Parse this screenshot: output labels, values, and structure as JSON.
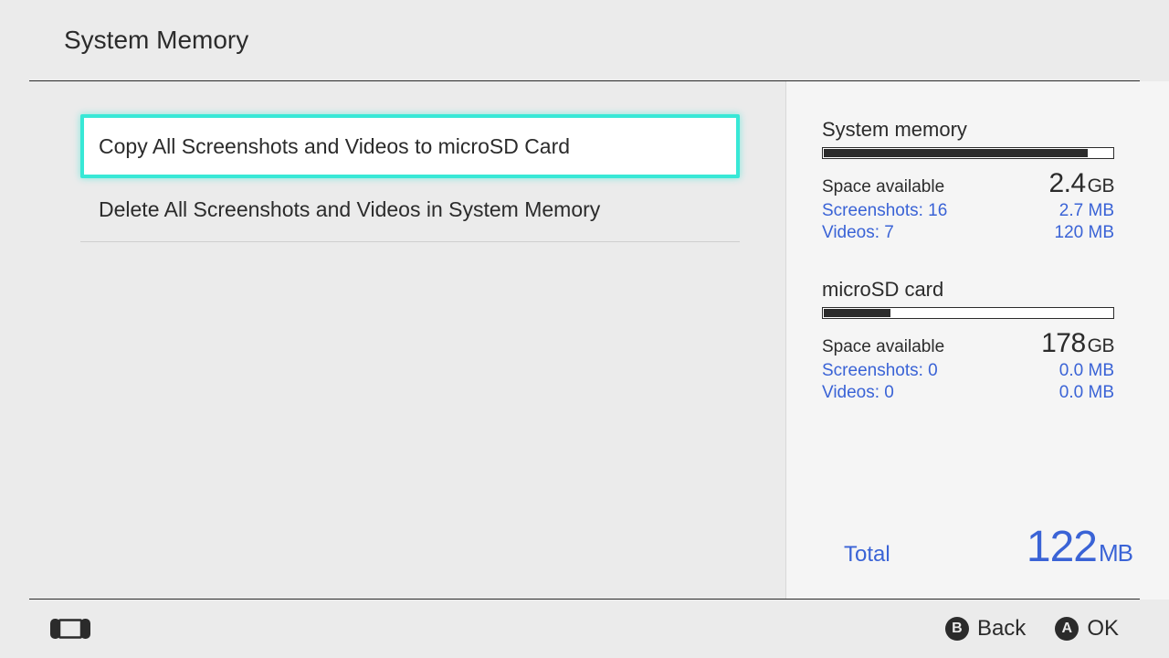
{
  "header": {
    "title": "System Memory"
  },
  "menu": {
    "items": [
      {
        "label": "Copy All Screenshots and Videos to microSD Card",
        "selected": true
      },
      {
        "label": "Delete All Screenshots and Videos in System Memory",
        "selected": false
      }
    ]
  },
  "panel": {
    "system": {
      "title": "System memory",
      "fill_pct": 91,
      "space_label": "Space available",
      "space_value": "2.4",
      "space_unit": "GB",
      "screenshots_label": "Screenshots: 16",
      "screenshots_value": "2.7 MB",
      "videos_label": "Videos: 7",
      "videos_value": "120 MB"
    },
    "microsd": {
      "title": "microSD card",
      "fill_pct": 23,
      "space_label": "Space available",
      "space_value": "178",
      "space_unit": "GB",
      "screenshots_label": "Screenshots: 0",
      "screenshots_value": "0.0 MB",
      "videos_label": "Videos: 0",
      "videos_value": "0.0 MB"
    },
    "total": {
      "label": "Total",
      "value": "122",
      "unit": "MB"
    }
  },
  "footer": {
    "back": {
      "letter": "B",
      "label": "Back"
    },
    "ok": {
      "letter": "A",
      "label": "OK"
    }
  }
}
